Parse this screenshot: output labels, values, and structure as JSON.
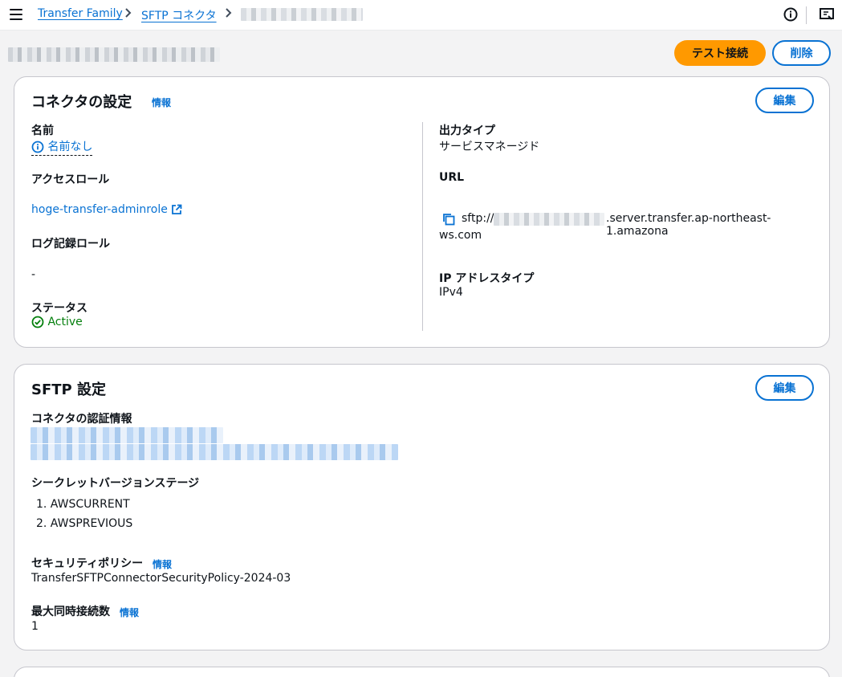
{
  "breadcrumb": {
    "items": [
      "Transfer Family",
      "SFTP コネクタ"
    ]
  },
  "header": {
    "test_button": "テスト接続",
    "delete_button": "削除"
  },
  "connector_settings": {
    "title": "コネクタの設定",
    "info": "情報",
    "edit": "編集",
    "name_label": "名前",
    "name_value": "名前なし",
    "access_role_label": "アクセスロール",
    "access_role_value": "hoge-transfer-adminrole",
    "log_role_label": "ログ記録ロール",
    "log_role_value": "-",
    "status_label": "ステータス",
    "status_value": "Active",
    "output_type_label": "出力タイプ",
    "output_type_value": "サービスマネージド",
    "url_label": "URL",
    "url_prefix": "sftp://",
    "url_suffix_line1": ".server.transfer.ap-northeast-1.amazona",
    "url_suffix_line2": "ws.com",
    "ip_type_label": "IP アドレスタイプ",
    "ip_type_value": "IPv4"
  },
  "sftp_settings": {
    "title": "SFTP 設定",
    "edit": "編集",
    "credentials_label": "コネクタの認証情報",
    "secret_stage_label": "シークレットバージョンステージ",
    "secret_stages": [
      "1. AWSCURRENT",
      "2. AWSPREVIOUS"
    ],
    "security_policy_label": "セキュリティポリシー",
    "security_policy_info": "情報",
    "security_policy_value": "TransferSFTPConnectorSecurityPolicy-2024-03",
    "max_connections_label": "最大同時接続数",
    "max_connections_info": "情報",
    "max_connections_value": "1"
  },
  "colors": {
    "link": "#0972d3",
    "primary": "#ff9900",
    "success": "#037f0c",
    "border": "#c6c6cd"
  },
  "icons": [
    "menu-icon",
    "chevron-right-icon",
    "info-circle-icon",
    "notifications-panel-icon",
    "external-link-icon",
    "copy-icon",
    "status-success-icon"
  ]
}
